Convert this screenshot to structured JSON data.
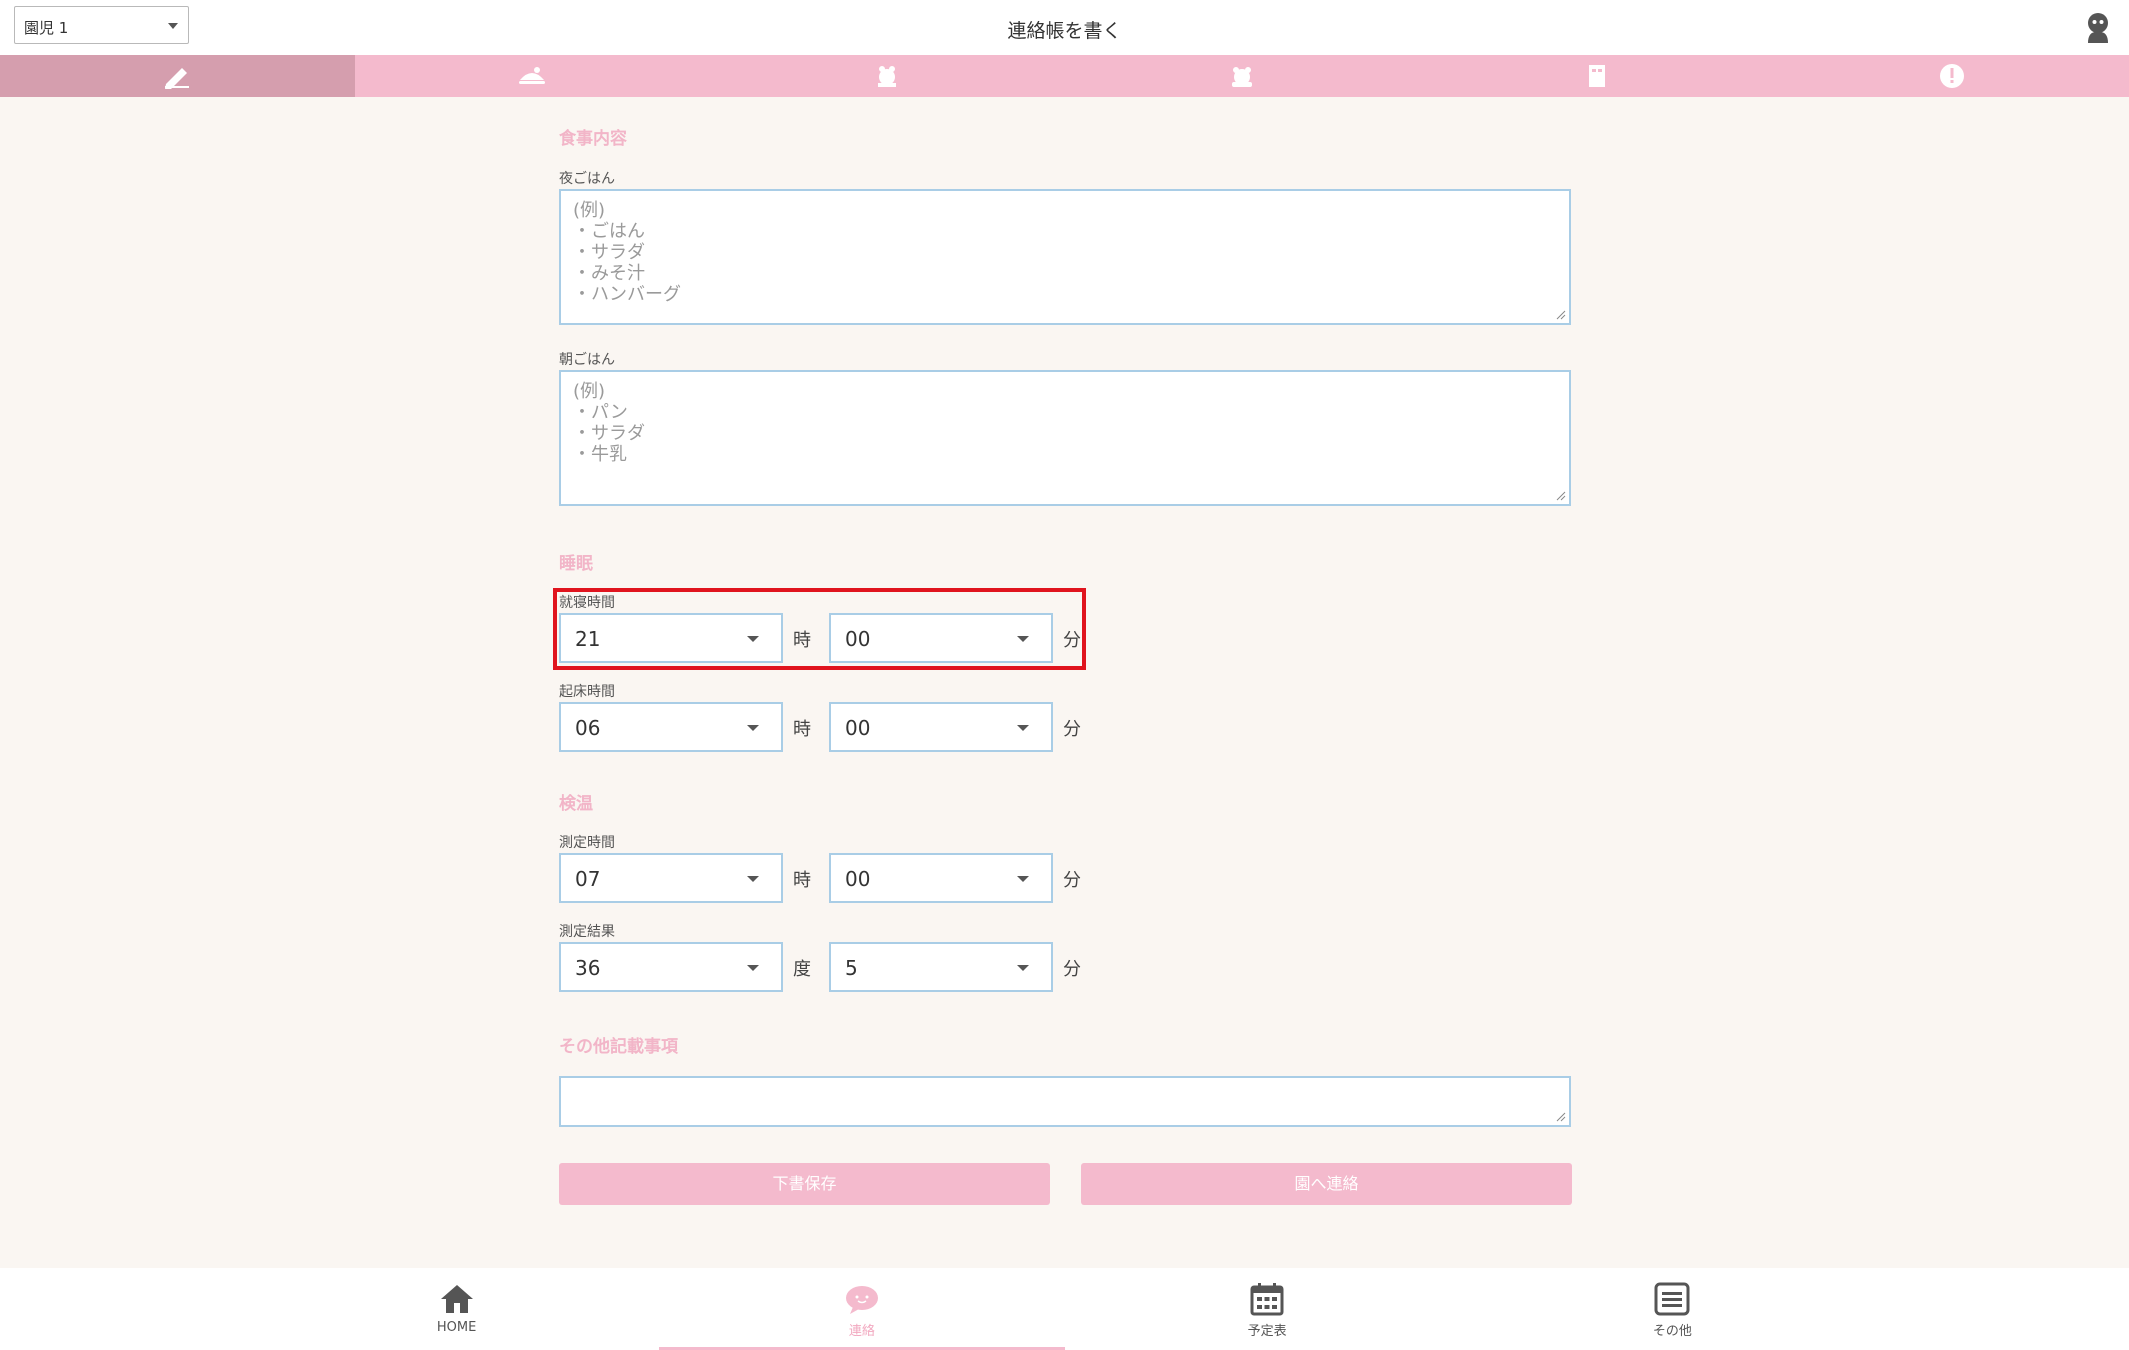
{
  "header": {
    "child_select": "園児 1",
    "title": "連絡帳を書く"
  },
  "tabs": [
    {
      "icon": "pencil-icon"
    },
    {
      "icon": "food-icon"
    },
    {
      "icon": "sleep-icon"
    },
    {
      "icon": "temperature-icon"
    },
    {
      "icon": "notebook-icon"
    },
    {
      "icon": "alert-icon"
    }
  ],
  "meal": {
    "title": "食事内容",
    "dinner": {
      "label": "夜ごはん",
      "placeholder_lines": [
        "(例)",
        "・ごはん",
        "・サラダ",
        "・みそ汁",
        "・ハンバーグ"
      ]
    },
    "breakfast": {
      "label": "朝ごはん",
      "placeholder_lines": [
        "(例)",
        "・パン",
        "・サラダ",
        "・牛乳"
      ]
    }
  },
  "sleep": {
    "title": "睡眠",
    "bedtime": {
      "label": "就寝時間",
      "hour": "21",
      "hour_unit": "時",
      "minute": "00",
      "minute_unit": "分"
    },
    "wakeup": {
      "label": "起床時間",
      "hour": "06",
      "hour_unit": "時",
      "minute": "00",
      "minute_unit": "分"
    }
  },
  "temperature": {
    "title": "検温",
    "time": {
      "label": "測定時間",
      "hour": "07",
      "hour_unit": "時",
      "minute": "00",
      "minute_unit": "分"
    },
    "result": {
      "label": "測定結果",
      "degree": "36",
      "degree_unit": "度",
      "decimal": "5",
      "decimal_unit": "分"
    }
  },
  "notes": {
    "title": "その他記載事項"
  },
  "buttons": {
    "draft": "下書保存",
    "send": "園へ連絡"
  },
  "bottom_nav": [
    {
      "label": "HOME",
      "icon": "home-icon"
    },
    {
      "label": "連絡",
      "icon": "message-icon"
    },
    {
      "label": "予定表",
      "icon": "calendar-icon"
    },
    {
      "label": "その他",
      "icon": "menu-icon"
    }
  ],
  "colors": {
    "accent": "#f4bacd",
    "accent_dark": "#d59eae",
    "section_title": "#f2b5c8",
    "input_border": "#a9cde6",
    "highlight": "#e0141e",
    "background": "#faf6f2"
  }
}
